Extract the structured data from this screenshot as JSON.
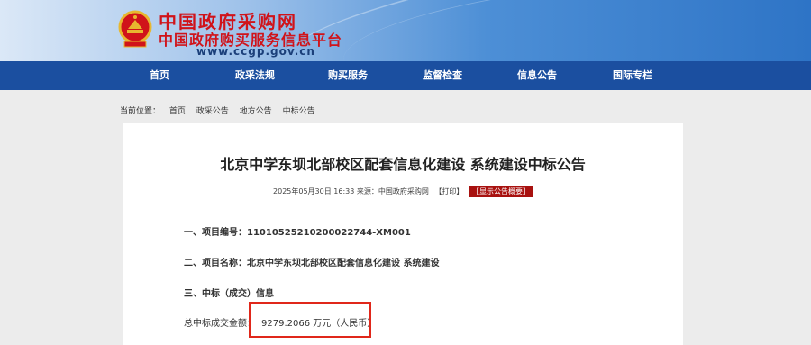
{
  "header": {
    "logo_title": "中国政府采购网",
    "logo_subtitle": "中国政府购买服务信息平台",
    "logo_url": "www.ccgp.gov.cn",
    "emblem_icon": "national-emblem-icon"
  },
  "nav": {
    "items": [
      "首页",
      "政采法规",
      "购买服务",
      "监督检查",
      "信息公告",
      "国际专栏"
    ]
  },
  "breadcrumb": {
    "prefix": "当前位置：",
    "items": [
      "首页",
      "政采公告",
      "地方公告",
      "中标公告"
    ]
  },
  "article": {
    "title": "北京中学东坝北部校区配套信息化建设 系统建设中标公告",
    "meta_text": "2025年05月30日 16:33 来源：中国政府采购网",
    "print_label": "【打印】",
    "summary_label": "【显示公告概要】",
    "sections": {
      "s1_label": "一、项目编号：",
      "s1_value": "11010525210200022744-XM001",
      "s2_label": "二、项目名称：",
      "s2_value": "北京中学东坝北部校区配套信息化建设 系统建设",
      "s3_label": "三、中标（成交）信息",
      "amount_label": "总中标成交金额：",
      "amount_value": "9279.2066 万元（人民币）"
    }
  },
  "colors": {
    "nav_bg": "#1b4fa0",
    "logo_red": "#d0131a",
    "highlight_box": "#e0271a"
  }
}
